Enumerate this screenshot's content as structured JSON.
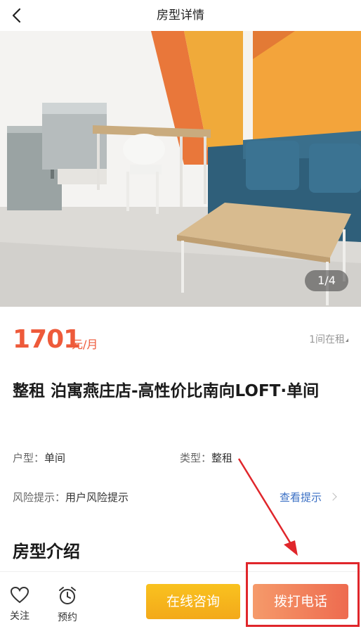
{
  "header": {
    "title": "房型详情"
  },
  "gallery": {
    "counter": "1/4"
  },
  "price": {
    "amount": "1701",
    "unit": "元/月",
    "rent_count": "1间在租"
  },
  "title": "整租 泊寓燕庄店-高性价比南向LOFT·单间",
  "attrs": {
    "layout_key": "户型：",
    "layout_val": "单间",
    "type_key": "类型：",
    "type_val": "整租"
  },
  "risk": {
    "key": "风险提示：",
    "value": "用户风险提示",
    "link": "查看提示"
  },
  "section": {
    "title": "房型介绍"
  },
  "bottom": {
    "follow": "关注",
    "reserve": "预约",
    "consult": "在线咨询",
    "call": "拨打电话"
  },
  "colors": {
    "price": "#ee5a3a",
    "consult": "#f3a91a",
    "call": "#ee6b4f",
    "annotation": "#e0262b"
  }
}
